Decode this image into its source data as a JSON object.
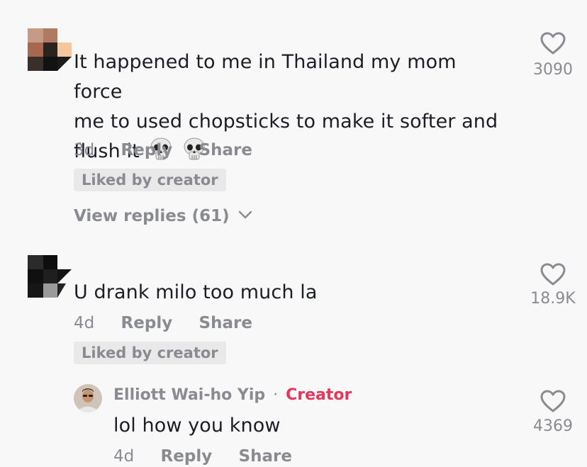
{
  "comments": [
    {
      "text": "It happened to me in Thailand my mom force me to used chopsticks to make it softer and flush it",
      "line1": "It happened to me in Thailand my mom force",
      "line2": "me to used chopsticks to make it softer and",
      "line3": "flush it",
      "emoji": [
        "skull-emoji",
        "skull-emoji"
      ],
      "time": "3d",
      "reply_label": "Reply",
      "share_label": "Share",
      "badge": "Liked by creator",
      "likes": "3090",
      "view_replies": "View replies (61)"
    },
    {
      "text": "U drank milo too much la",
      "time": "4d",
      "reply_label": "Reply",
      "share_label": "Share",
      "badge": "Liked by creator",
      "likes": "18.9K",
      "reply": {
        "author": "Elliott Wai-ho Yip",
        "separator": "·",
        "role": "Creator",
        "text": "lol how you know",
        "time": "4d",
        "reply_label": "Reply",
        "share_label": "Share",
        "likes": "4369"
      }
    }
  ],
  "colors": {
    "background": "#f8f8f8",
    "text": "#1c1d26",
    "muted": "#8a8b91",
    "creator": "#e4375a",
    "badge_bg": "#e9e9ea"
  }
}
